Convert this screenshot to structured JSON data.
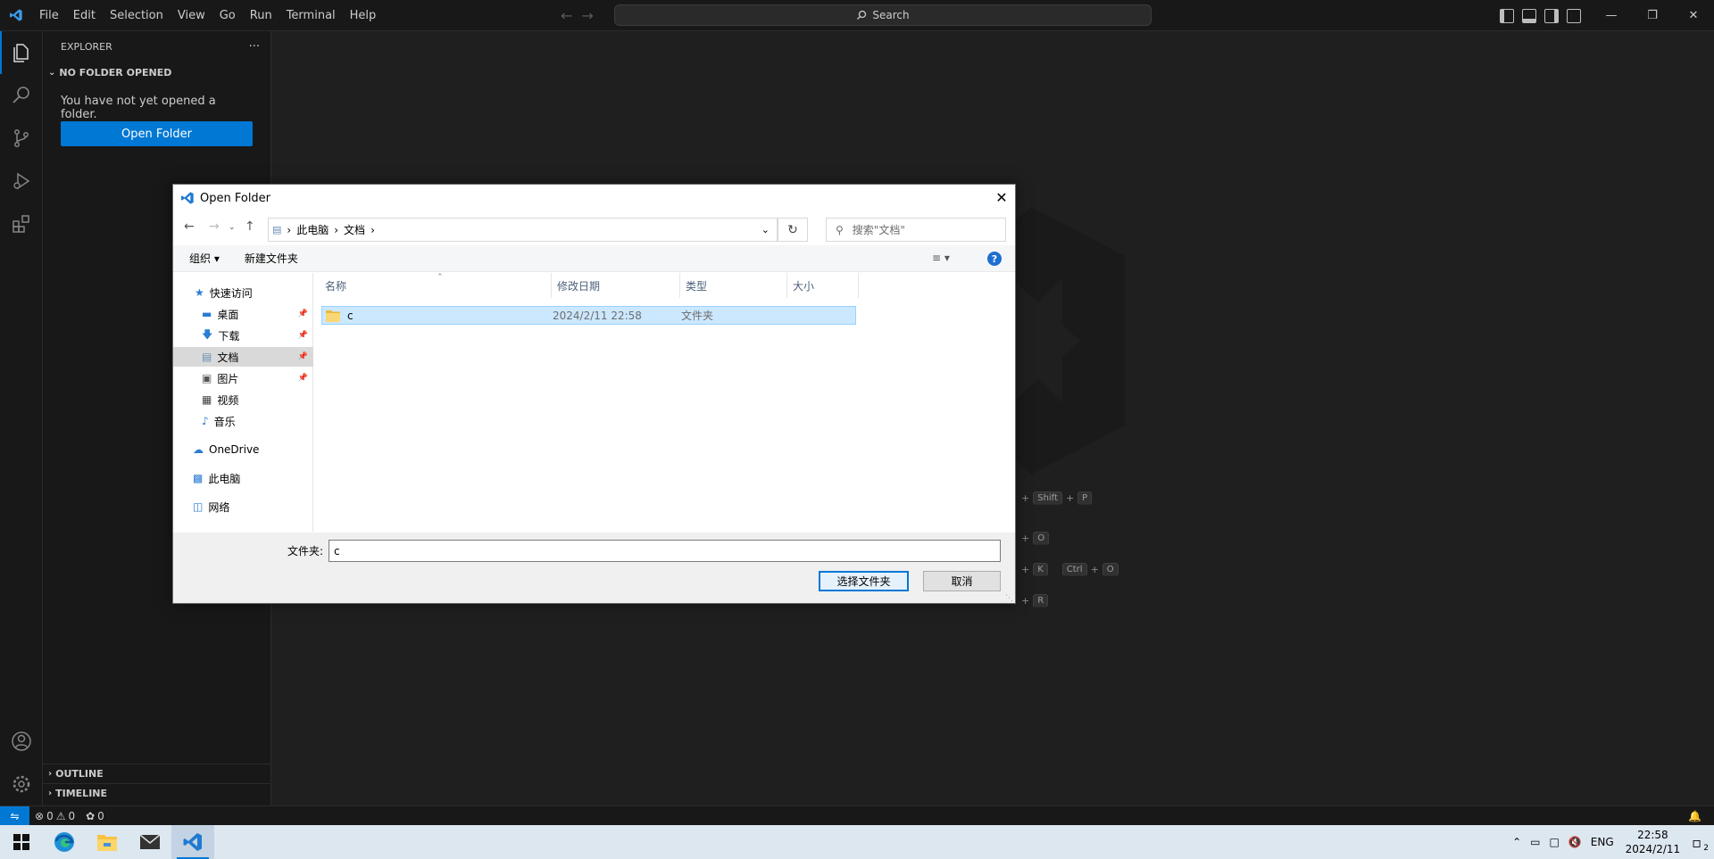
{
  "menubar": {
    "items": [
      "File",
      "Edit",
      "Selection",
      "View",
      "Go",
      "Run",
      "Terminal",
      "Help"
    ]
  },
  "command_center": {
    "label": "Search"
  },
  "sidebar": {
    "title": "EXPLORER",
    "more_label": "···",
    "section": "NO FOLDER OPENED",
    "message": "You have not yet opened a folder.",
    "open_folder_button": "Open Folder",
    "outline": "OUTLINE",
    "timeline": "TIMELINE"
  },
  "shortcuts": [
    {
      "keys": [
        "Shift",
        "P"
      ]
    },
    {
      "keys": [
        "O"
      ]
    },
    {
      "keys": [
        "K",
        "Ctrl",
        "O"
      ]
    },
    {
      "keys": [
        "R"
      ]
    }
  ],
  "statusbar": {
    "errors": "0",
    "warnings": "0",
    "ports": "0"
  },
  "dialog": {
    "title": "Open Folder",
    "breadcrumb": [
      "此电脑",
      "文档"
    ],
    "search_placeholder": "搜索\"文档\"",
    "toolbar": {
      "organize": "组织",
      "new_folder": "新建文件夹"
    },
    "nav_pane": {
      "quick_access": "快速访问",
      "items": [
        "桌面",
        "下载",
        "文档",
        "图片",
        "视频",
        "音乐"
      ],
      "onedrive": "OneDrive",
      "this_pc": "此电脑",
      "network": "网络"
    },
    "columns": [
      "名称",
      "修改日期",
      "类型",
      "大小"
    ],
    "files": [
      {
        "name": "c",
        "modified": "2024/2/11 22:58",
        "type": "文件夹",
        "size": ""
      }
    ],
    "folder_label": "文件夹:",
    "folder_value": "c",
    "select_button": "选择文件夹",
    "cancel_button": "取消"
  },
  "taskbar": {
    "tray_lang": "ENG",
    "time": "22:58",
    "date": "2024/2/11",
    "notification_count": "2"
  },
  "colors": {
    "accent": "#0078d4",
    "editor_bg": "#1f1f1f",
    "sidebar_bg": "#181818",
    "selection": "#cce8ff"
  }
}
